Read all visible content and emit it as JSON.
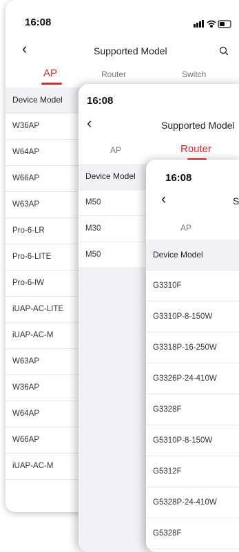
{
  "screens": [
    {
      "time": "16:08",
      "title": "Supported Model",
      "tabs": [
        "AP",
        "Router",
        "Switch"
      ],
      "active_tab": "AP",
      "header": "Device Model",
      "rows": [
        "W36AP",
        "W64AP",
        "W66AP",
        "W63AP",
        "Pro-6-LR",
        "Pro-6-LITE",
        "Pro-6-IW",
        "iUAP-AC-LITE",
        "iUAP-AC-M",
        "W63AP",
        "W36AP",
        "W64AP",
        "W66AP",
        "iUAP-AC-M"
      ]
    },
    {
      "time": "16:08",
      "title": "Supported Model",
      "tabs": [
        "AP",
        "Router"
      ],
      "active_tab": "Router",
      "header": "Device Model",
      "rows": [
        "M50",
        "M30",
        "M50"
      ]
    },
    {
      "time": "16:08",
      "title": "S",
      "tabs": [
        "AP"
      ],
      "active_tab": "",
      "header": "Device Model",
      "rows": [
        "G3310F",
        "G3310P-8-150W",
        "G3318P-16-250W",
        "G3326P-24-410W",
        "G3328F",
        "G5310P-8-150W",
        "G5312F",
        "G5328P-24-410W",
        "G5328F"
      ]
    }
  ],
  "colors": {
    "accent": "#d9272e",
    "header_bg": "#f2f2f4"
  },
  "icons": [
    "back-icon",
    "search-icon",
    "signal-icon",
    "wifi-icon",
    "battery-icon"
  ]
}
